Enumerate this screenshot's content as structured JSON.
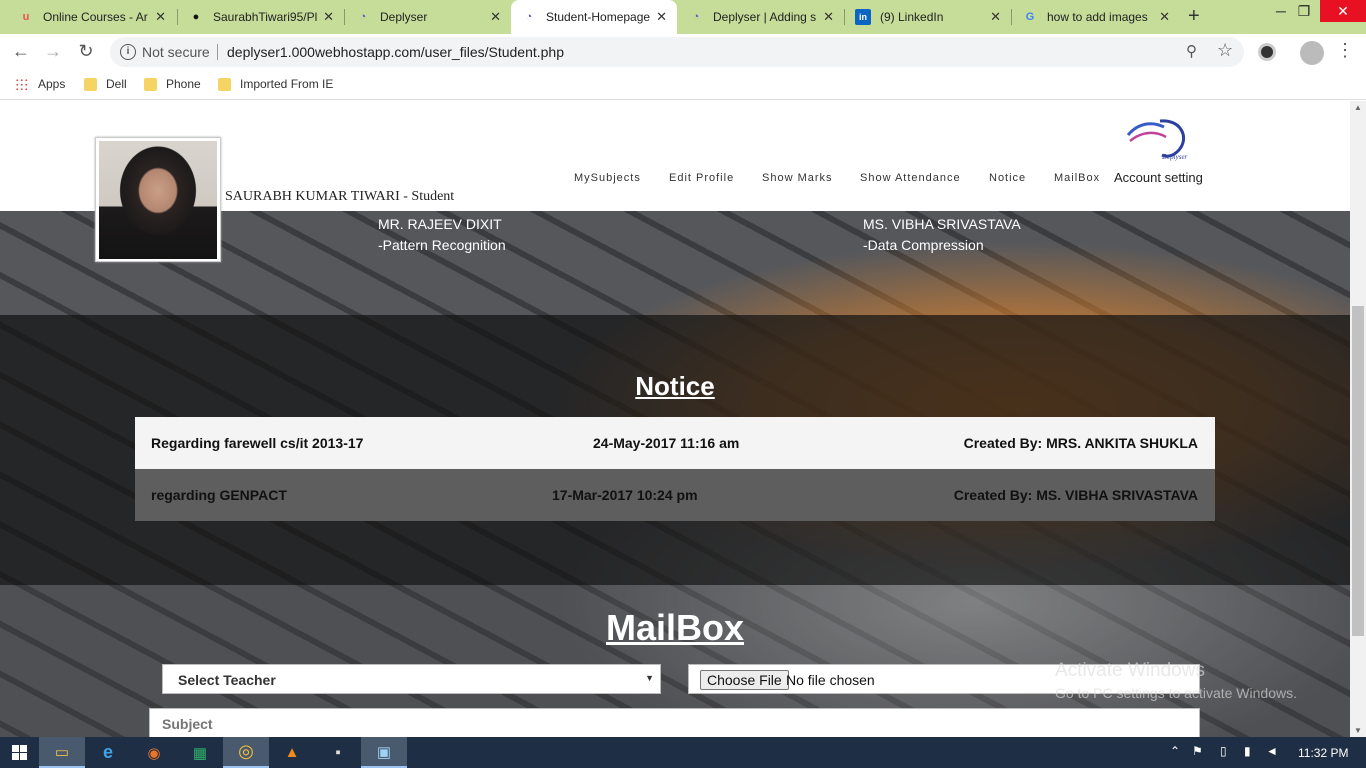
{
  "browser": {
    "tabs": [
      {
        "title": "Online Courses - Ar",
        "icon": "udemy-icon",
        "icon_char": "u",
        "icon_color": "#ec5252"
      },
      {
        "title": "SaurabhTiwari95/Pl",
        "icon": "github-icon",
        "icon_char": "●",
        "icon_color": "#111111"
      },
      {
        "title": "Deplyser",
        "icon": "deplyser-icon",
        "icon_char": "◔",
        "icon_color": "#6a4fcf"
      },
      {
        "title": "Student-Homepage",
        "icon": "deplyser-icon",
        "icon_char": "◔",
        "icon_color": "#6a4fcf",
        "active": true
      },
      {
        "title": "Deplyser | Adding s",
        "icon": "deplyser-icon",
        "icon_char": "◔",
        "icon_color": "#6a4fcf"
      },
      {
        "title": "(9) LinkedIn",
        "icon": "linkedin-icon",
        "icon_char": "in",
        "icon_color": "#0a66c2"
      },
      {
        "title": "how to add images",
        "icon": "google-icon",
        "icon_char": "G",
        "icon_color": "#4285f4"
      }
    ],
    "tab_close": "✕",
    "new_tab": "+",
    "window_controls": {
      "minimize": "─",
      "maximize": "❐",
      "close": "✕"
    },
    "nav": {
      "back": "←",
      "forward": "→",
      "reload": "↻"
    },
    "security_label": "Not secure",
    "info_icon_char": "i",
    "url": "deplyser1.000webhostapp.com/user_files/Student.php",
    "zoom_icon_char": "⚲",
    "star_icon_char": "☆",
    "menu_icon_char": "⋮",
    "bookmarks": [
      {
        "label": "Apps",
        "icon": "apps-icon"
      },
      {
        "label": "Dell",
        "icon": "folder-icon"
      },
      {
        "label": "Phone",
        "icon": "folder-icon"
      },
      {
        "label": "Imported From IE",
        "icon": "folder-icon"
      }
    ]
  },
  "header": {
    "student_name": "SAURABH KUMAR TIWARI  - Student",
    "nav": [
      "MySubjects",
      "Edit Profile",
      "Show Marks",
      "Show Attendance",
      "Notice",
      "MailBox"
    ],
    "account_setting": "Account setting",
    "logo_text": "Deplyser"
  },
  "teachers": [
    {
      "name": "MR. RAJEEV DIXIT",
      "subject": "-Pattern Recognition"
    },
    {
      "name": "MS. VIBHA SRIVASTAVA",
      "subject": "-Data Compression"
    }
  ],
  "notice": {
    "title": "Notice",
    "rows": [
      {
        "title": "Regarding farewell cs/it 2013-17",
        "date": "24-May-2017 11:16 am",
        "created_by": "Created By: MRS. ANKITA SHUKLA"
      },
      {
        "title": "regarding GENPACT",
        "date": "17-Mar-2017 10:24 pm",
        "created_by": "Created By: MS. VIBHA SRIVASTAVA"
      }
    ]
  },
  "mailbox": {
    "title": "MailBox",
    "select_teacher": "Select Teacher",
    "select_arrow": "▼",
    "choose_file": "Choose File",
    "no_file": "No file chosen",
    "subject_placeholder": "Subject"
  },
  "watermark": {
    "title": "Activate Windows",
    "subtitle": "Go to PC settings to activate Windows."
  },
  "scrollbar": {
    "up": "▲",
    "down": "▼"
  },
  "taskbar": {
    "apps": [
      {
        "name": "file-explorer-icon",
        "char": "▭",
        "active": true
      },
      {
        "name": "internet-explorer-icon",
        "char": "e"
      },
      {
        "name": "firefox-icon",
        "char": "◉"
      },
      {
        "name": "excel-icon",
        "char": "▦"
      },
      {
        "name": "chrome-icon",
        "char": "◎",
        "active": true
      },
      {
        "name": "vlc-icon",
        "char": "▲"
      },
      {
        "name": "cmd-icon",
        "char": "▪"
      },
      {
        "name": "photos-icon",
        "char": "▣",
        "active": true
      }
    ],
    "tray": {
      "up": "⌃",
      "flag": "⚑",
      "battery": "▯",
      "network": "▮",
      "volume": "◄"
    },
    "time": "11:32 PM"
  }
}
